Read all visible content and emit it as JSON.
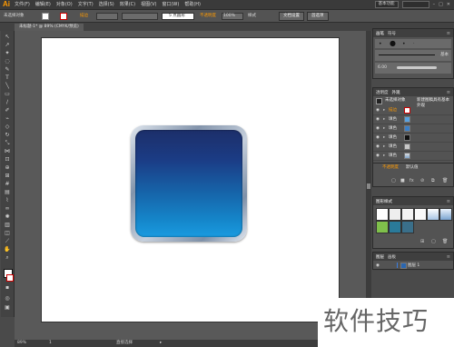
{
  "app": {
    "logo": "Ai"
  },
  "menu": [
    "文件(F)",
    "编辑(E)",
    "对象(O)",
    "文字(T)",
    "选择(S)",
    "效果(C)",
    "视图(V)",
    "窗口(W)",
    "帮助(H)"
  ],
  "menubar_right": {
    "workspace": "基本功能",
    "search_placeholder": ""
  },
  "control": {
    "selection_label": "未选择对象",
    "stroke_label": "描边",
    "style_label": "5 点圆形",
    "opacity_label": "不透明度",
    "opacity_value": "100%",
    "style2_label": "样式",
    "doc_setup_button": "文档设置",
    "prefs_button": "首选项"
  },
  "tab": {
    "label": "未标题-1* @ 89% (CMYK/预览)"
  },
  "status": {
    "zoom": "89%",
    "page": "1",
    "tool": "直接选择"
  },
  "brushes_panel": {
    "tabs": [
      "画笔",
      "符号"
    ],
    "basic_label": "基本",
    "size_label": "6.00"
  },
  "appearance_panel": {
    "tabs": [
      "透明度",
      "外观"
    ],
    "header_label": "未选择对象",
    "header_label2": "新建图稿具有基本外观",
    "rows": [
      {
        "label": "描边"
      },
      {
        "label": "填色"
      },
      {
        "label": "填色"
      },
      {
        "label": "填色"
      },
      {
        "label": "填色"
      },
      {
        "label": "填色"
      }
    ],
    "opacity_row": {
      "label": "不透明度",
      "value": "默认值"
    }
  },
  "graphic_styles_panel": {
    "tabs": [
      "图形样式"
    ]
  },
  "layers_panel": {
    "tabs": [
      "图层",
      "画板"
    ],
    "layer_name": "图层 1"
  },
  "colors": {
    "accent": "#ff9a00",
    "button_top": "#1c2f6a",
    "button_bottom": "#1a9be0"
  },
  "watermark": {
    "text": "软件技巧"
  }
}
